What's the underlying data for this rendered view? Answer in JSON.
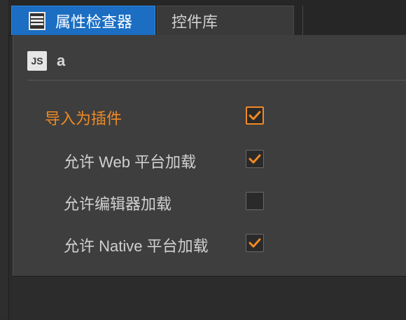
{
  "tabs": [
    {
      "label": "属性检查器",
      "active": true,
      "icon": "inspector-icon"
    },
    {
      "label": "控件库",
      "active": false
    }
  ],
  "file": {
    "badge": "JS",
    "name": "a",
    "icon": "js-file-icon"
  },
  "options": [
    {
      "label": "导入为插件",
      "checked": true,
      "emphasis": true
    },
    {
      "label": "允许 Web 平台加载",
      "checked": true,
      "emphasis": false
    },
    {
      "label": "允许编辑器加载",
      "checked": false,
      "emphasis": false
    },
    {
      "label": "允许 Native 平台加载",
      "checked": true,
      "emphasis": false
    }
  ],
  "colors": {
    "accent": "#f08a24",
    "tab_active": "#1b6ec2",
    "panel": "#3e3e3e"
  }
}
